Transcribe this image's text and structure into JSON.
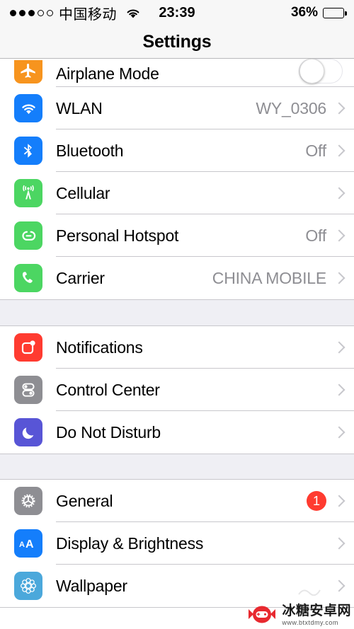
{
  "status_bar": {
    "signal_dots_filled": 3,
    "signal_dots_empty": 2,
    "carrier": "中国移动",
    "wifi_icon": "wifi-icon",
    "time": "23:39",
    "battery_percent": "36%",
    "battery_level": 36
  },
  "nav": {
    "title": "Settings"
  },
  "groups": [
    {
      "id": "connectivity",
      "clipped_top": true,
      "rows": [
        {
          "name": "airplane-mode",
          "icon": "airplane-icon",
          "label": "Airplane Mode",
          "accessory": "toggle",
          "toggle_on": false,
          "clipped": true
        },
        {
          "name": "wlan",
          "icon": "wifi-icon",
          "label": "WLAN",
          "accessory": "value",
          "value": "WY_0306"
        },
        {
          "name": "bluetooth",
          "icon": "bluetooth-icon",
          "label": "Bluetooth",
          "accessory": "value",
          "value": "Off"
        },
        {
          "name": "cellular",
          "icon": "cellular-tower-icon",
          "label": "Cellular",
          "accessory": "chevron",
          "value": ""
        },
        {
          "name": "personal-hotspot",
          "icon": "hotspot-link-icon",
          "label": "Personal Hotspot",
          "accessory": "value",
          "value": "Off"
        },
        {
          "name": "carrier",
          "icon": "phone-icon",
          "label": "Carrier",
          "accessory": "value",
          "value": "CHINA MOBILE"
        }
      ]
    },
    {
      "id": "alerts",
      "clipped_top": false,
      "rows": [
        {
          "name": "notifications",
          "icon": "notification-icon",
          "label": "Notifications",
          "accessory": "chevron",
          "value": ""
        },
        {
          "name": "control-center",
          "icon": "switches-icon",
          "label": "Control Center",
          "accessory": "chevron",
          "value": ""
        },
        {
          "name": "do-not-disturb",
          "icon": "moon-icon",
          "label": "Do Not Disturb",
          "accessory": "chevron",
          "value": ""
        }
      ]
    },
    {
      "id": "system",
      "clipped_top": false,
      "rows": [
        {
          "name": "general",
          "icon": "gear-icon",
          "label": "General",
          "accessory": "badge",
          "badge": "1"
        },
        {
          "name": "display-brightness",
          "icon": "aa-text-icon",
          "label": "Display & Brightness",
          "accessory": "chevron",
          "value": ""
        },
        {
          "name": "wallpaper",
          "icon": "flower-icon",
          "label": "Wallpaper",
          "accessory": "chevron",
          "value": ""
        }
      ]
    }
  ],
  "watermark": {
    "site_name": "冰糖安卓网",
    "url": "www.btxtdmy.com",
    "logo": "candy-gamepad-logo"
  },
  "colors": {
    "accent_blue": "#147efb",
    "green": "#4cd662",
    "red": "#ff3b30",
    "orange": "#f7941e",
    "gray": "#8e8e93",
    "indigo": "#5855d6",
    "light_blue": "#4ba8db",
    "group_bg": "#efeff4",
    "separator": "#c8c7cc",
    "value_text": "#8e8e93"
  }
}
